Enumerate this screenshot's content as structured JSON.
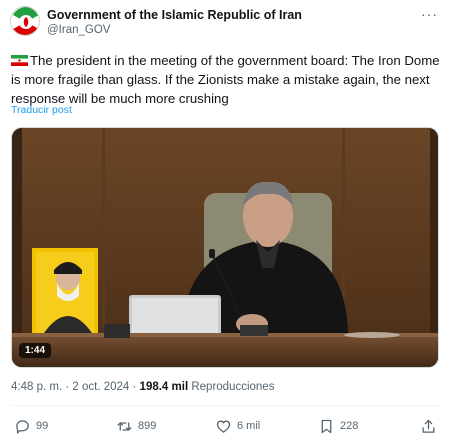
{
  "author": {
    "name": "Government of the Islamic Republic of Iran",
    "handle": "@Iran_GOV"
  },
  "tweet": {
    "text": "The president in the meeting of the government board: The Iron Dome is more fragile than glass. If the Zionists make a mistake again, the next response will be much more crushing",
    "translate_label": "Traducir post"
  },
  "media": {
    "duration": "1:44"
  },
  "meta": {
    "time": "4:48 p. m.",
    "separator": "·",
    "date": "2 oct. 2024",
    "views_count": "198.4 mil",
    "views_label": "Reproducciones"
  },
  "actions": {
    "replies": "99",
    "reposts": "899",
    "likes": "6 mil",
    "bookmarks": "228"
  },
  "icons": [
    "emblem-avatar-icon",
    "more-options-icon",
    "iran-flag-icon",
    "reply-icon",
    "repost-icon",
    "like-icon",
    "bookmark-icon",
    "share-icon"
  ],
  "colors": {
    "link": "#1d9bf0",
    "secondary_text": "#536471",
    "primary_text": "#0f1419"
  }
}
